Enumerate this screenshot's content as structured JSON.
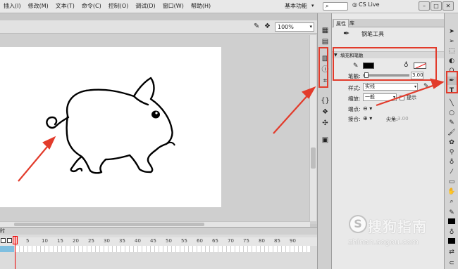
{
  "menu": {
    "items": [
      "插入(I)",
      "修改(M)",
      "文本(T)",
      "命令(C)",
      "控制(O)",
      "调试(D)",
      "窗口(W)",
      "帮助(H)"
    ],
    "workspace": "基本功能",
    "cslive": "CS Live"
  },
  "stage": {
    "zoom": "100%"
  },
  "timeline": {
    "label": "时",
    "frames": [
      "5",
      "10",
      "15",
      "20",
      "25",
      "30",
      "35",
      "40",
      "45",
      "50",
      "55",
      "60",
      "65",
      "70",
      "75",
      "80",
      "85",
      "90"
    ]
  },
  "panel": {
    "tabs": [
      "属性",
      "库"
    ],
    "tool_name": "钢笔工具",
    "section_title": "填充和笔触",
    "stroke_label": "笔触:",
    "stroke_value": "3.00",
    "style_label": "样式:",
    "style_value": "实线",
    "scale_label": "缩放:",
    "scale_value": "一般",
    "hint_label": "提示",
    "cap_label": "端点:",
    "join_label": "接合:",
    "sharp_label": "尖角:",
    "sharp_value": "3.00"
  },
  "colors": {
    "stroke": "#000000",
    "fill": "none",
    "highlight": "#e23b2b"
  },
  "watermark": {
    "text": "搜狗指南",
    "url": "zhinan.sogou.com",
    "logo": "S"
  }
}
